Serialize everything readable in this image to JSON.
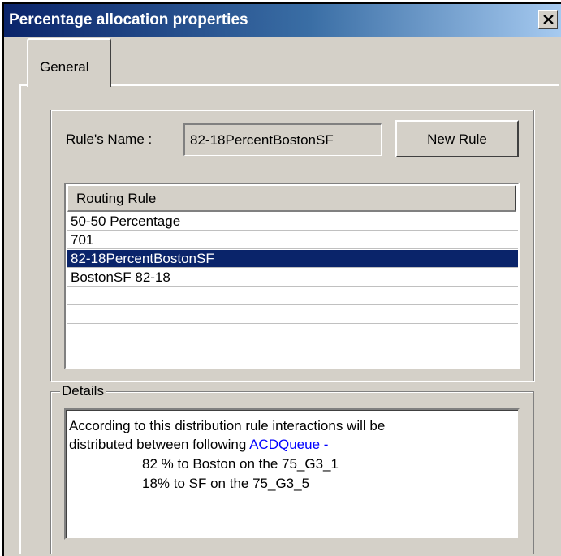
{
  "window": {
    "title": "Percentage allocation properties",
    "close_icon": "close-icon"
  },
  "tabs": [
    {
      "label": "General",
      "selected": true
    }
  ],
  "rule": {
    "name_label": "Rule's Name :",
    "name_value": "82-18PercentBostonSF",
    "new_rule_label": "New Rule"
  },
  "routing_list": {
    "header": "Routing Rule",
    "rows": [
      "50-50 Percentage",
      "701",
      "82-18PercentBostonSF",
      "BostonSF 82-18",
      "",
      ""
    ],
    "selected_index": 2
  },
  "details": {
    "legend": "Details",
    "line1": "According to this distribution rule interactions will be",
    "line2_prefix": "distributed between following ",
    "line2_link": "ACDQueue -",
    "line3": "82 % to Boston on the 75_G3_1",
    "line4": "18% to SF on the 75_G3_5"
  },
  "colors": {
    "titlebar_start": "#0a246a",
    "selection": "#0a246a",
    "link": "#0000ff",
    "face": "#d4d0c8"
  }
}
